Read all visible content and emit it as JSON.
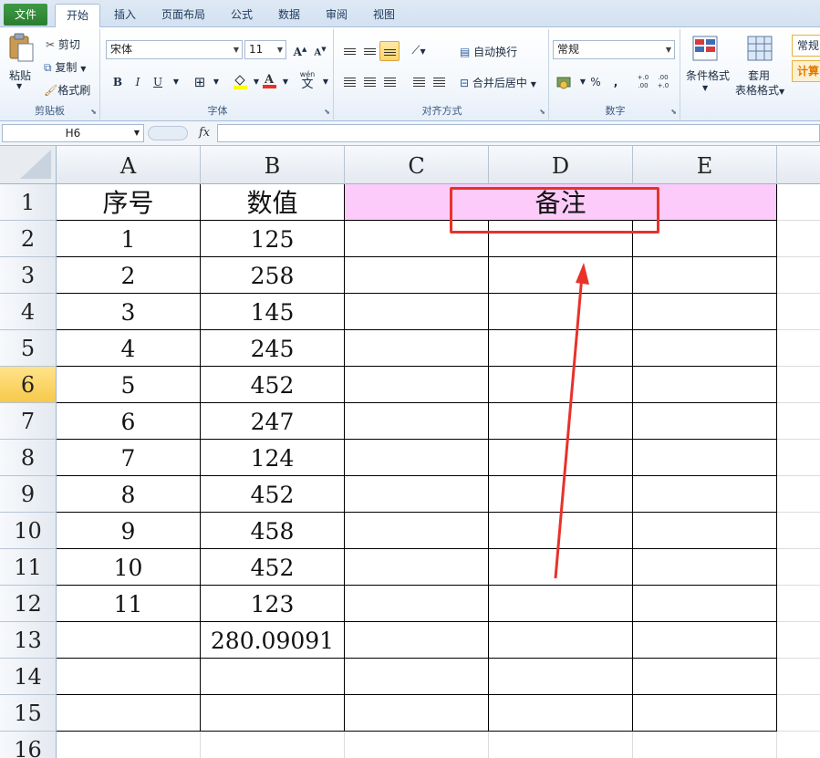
{
  "ribbon_tabs": [
    "文件",
    "开始",
    "插入",
    "页面布局",
    "公式",
    "数据",
    "审阅",
    "视图"
  ],
  "clipboard": {
    "paste": "粘贴",
    "cut": "剪切",
    "copy": "复制",
    "format_painter": "格式刷",
    "label": "剪贴板"
  },
  "font": {
    "name": "宋体",
    "size": "11",
    "bold": "B",
    "italic": "I",
    "underline": "U",
    "phonetic": "wén",
    "label": "字体"
  },
  "alignment": {
    "wrap_text": "自动换行",
    "merge_center": "合并后居中",
    "label": "对齐方式"
  },
  "number": {
    "format": "常规",
    "percent": "%",
    "comma": ",",
    "inc_decimal": "+.0 .00",
    "dec_decimal": ".00 +.0",
    "label": "数字"
  },
  "styles": {
    "conditional": "条件格式",
    "table_format_1": "套用",
    "table_format_2": "表格格式",
    "style_normal": "常规",
    "style_calc": "计算"
  },
  "formula_bar": {
    "name_box": "H6",
    "fx": "fx",
    "content": ""
  },
  "columns": [
    "A",
    "B",
    "C",
    "D",
    "E"
  ],
  "rows": [
    "1",
    "2",
    "3",
    "4",
    "5",
    "6",
    "7",
    "8",
    "9",
    "10",
    "11",
    "12",
    "13",
    "14",
    "15",
    "16"
  ],
  "active_row": "6",
  "headers": {
    "a1": "序号",
    "b1": "数值",
    "remark": "备注"
  },
  "data_rows": [
    {
      "a": "1",
      "b": "125"
    },
    {
      "a": "2",
      "b": "258"
    },
    {
      "a": "3",
      "b": "145"
    },
    {
      "a": "4",
      "b": "245"
    },
    {
      "a": "5",
      "b": "452"
    },
    {
      "a": "6",
      "b": "247"
    },
    {
      "a": "7",
      "b": "124"
    },
    {
      "a": "8",
      "b": "452"
    },
    {
      "a": "9",
      "b": "458"
    },
    {
      "a": "10",
      "b": "452"
    },
    {
      "a": "11",
      "b": "123"
    },
    {
      "a": "",
      "b": "280.09091"
    }
  ],
  "colors": {
    "remark_fill": "#fccbf9",
    "annotation": "#e8322a",
    "active_row_header": "#f7c94a"
  }
}
